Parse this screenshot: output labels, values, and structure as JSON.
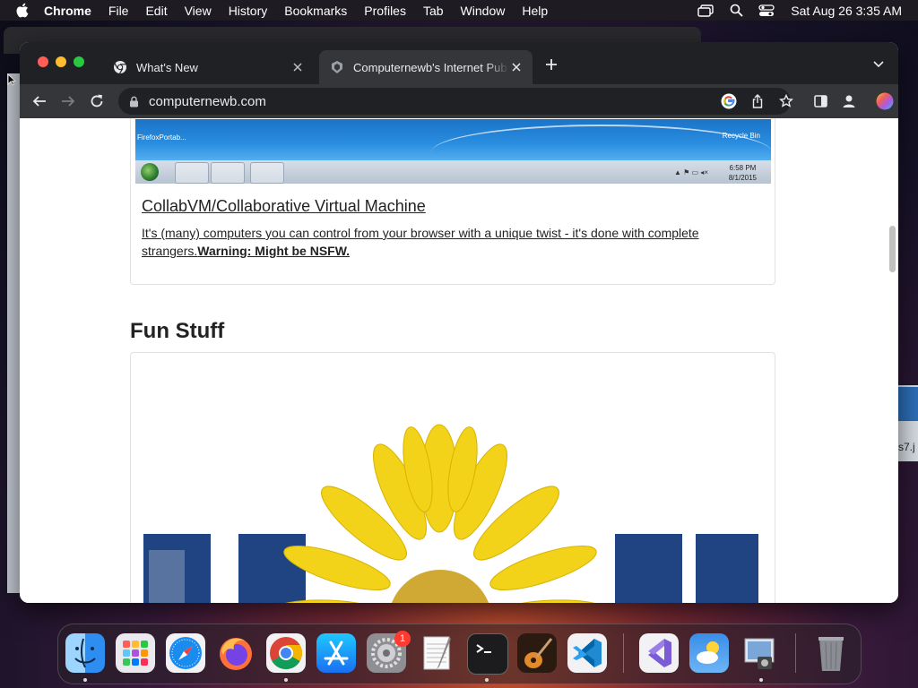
{
  "menubar": {
    "app_name": "Chrome",
    "items": [
      "File",
      "Edit",
      "View",
      "History",
      "Bookmarks",
      "Profiles",
      "Tab",
      "Window",
      "Help"
    ],
    "clock": "Sat Aug 26  3:35 AM",
    "icons": [
      "screen-mirroring-icon",
      "spotlight-search-icon",
      "control-center-icon"
    ]
  },
  "browser": {
    "tabs": [
      {
        "title": "What's New",
        "favicon": "chrome-icon",
        "active": false
      },
      {
        "title": "Computernewb's Internet Pub Ho",
        "favicon": "computernewb-icon",
        "active": true
      }
    ],
    "address": "computernewb.com"
  },
  "page": {
    "screenshot": {
      "desktop_icon_label": "FirefoxPortab...",
      "recycle_bin_label": "Recycle Bin",
      "clock_time": "6:58 PM",
      "clock_date": "8/1/2015"
    },
    "card_title": "CollabVM/Collaborative Virtual Machine",
    "card_desc": "It's (many) computers you can control from your browser with a unique twist - it's done with complete strangers.",
    "card_warning": "Warning: Might be NSFW.",
    "section_title": "Fun Stuff"
  },
  "dock": {
    "apps": [
      "finder-icon",
      "launchpad-icon",
      "safari-icon",
      "firefox-icon",
      "chrome-icon",
      "app-store-icon",
      "system-settings-icon",
      "textedit-icon",
      "terminal-icon",
      "garageband-icon",
      "vscode-icon",
      "visual-studio-icon",
      "weather-icon",
      "preview-icon",
      "trash-icon"
    ],
    "settings_badge": "1"
  },
  "colors": {
    "tabstrip": "#202124",
    "toolbar": "#35363a",
    "accent_blue": "#1a73e8"
  }
}
